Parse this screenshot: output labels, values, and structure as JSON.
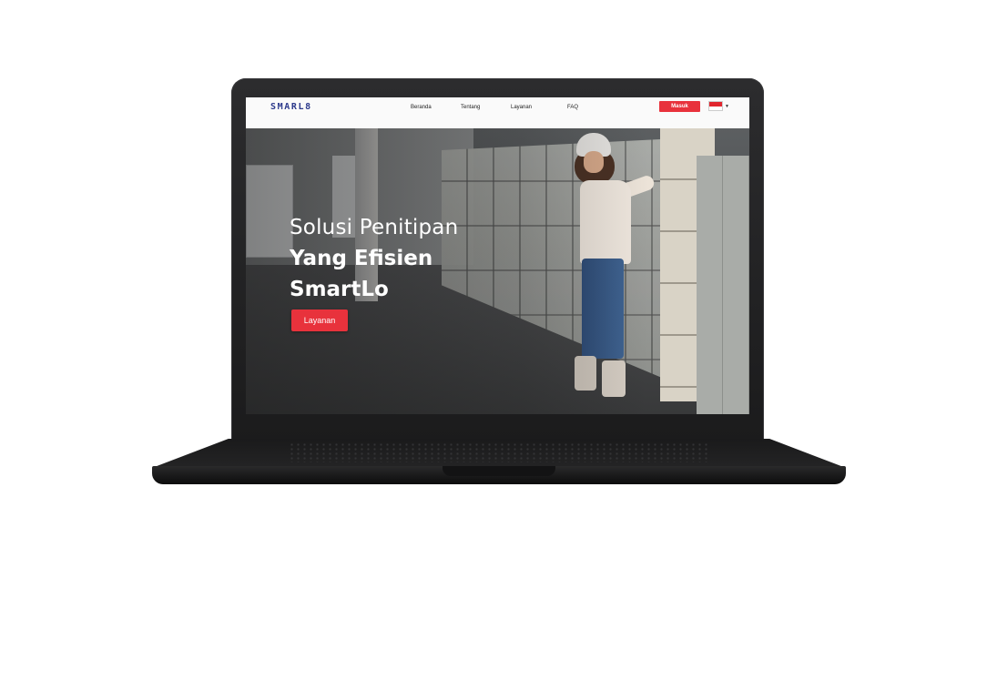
{
  "site": {
    "logo": "SMARL8",
    "nav": {
      "items": [
        {
          "label": "Beranda"
        },
        {
          "label": "Tentang"
        },
        {
          "label": "Layanan"
        },
        {
          "label": "FAQ"
        }
      ],
      "login_label": "Masuk",
      "language_icon": "indonesia-flag-icon"
    },
    "hero": {
      "line1": "Solusi Penitipan",
      "line2": "Yang Efisien",
      "line3": "SmartLo",
      "button_label": "Layanan"
    }
  },
  "colors": {
    "accent": "#e8323c",
    "logo": "#2d3a8c",
    "nav_background": "#fafafa",
    "device": "#1b1b1c"
  }
}
